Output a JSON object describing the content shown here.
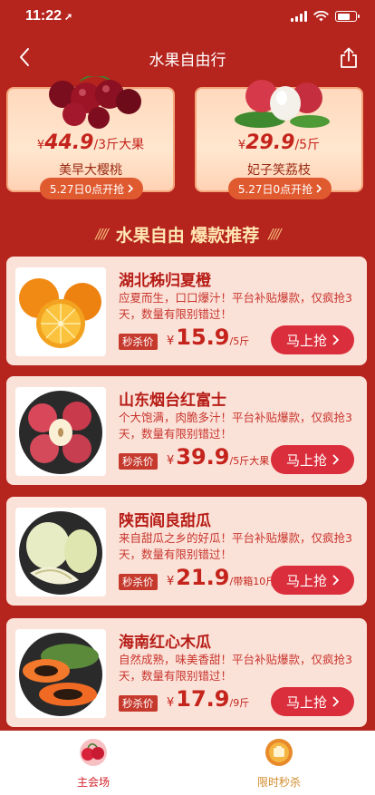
{
  "status": {
    "time": "11:22",
    "location_glyph": "➚"
  },
  "nav": {
    "title": "水果自由行"
  },
  "promos": [
    {
      "price_symbol": "¥",
      "price": "44.9",
      "unit": "/3斤大果",
      "name": "美早大樱桃",
      "button": "5.27日0点开抢",
      "icon": "cherries"
    },
    {
      "price_symbol": "¥",
      "price": "29.9",
      "unit": "/5斤",
      "name": "妃子笑荔枝",
      "button": "5.27日0点开抢",
      "icon": "lychees"
    }
  ],
  "section": {
    "title": "水果自由 爆款推荐",
    "slashes": "////"
  },
  "products": [
    {
      "name": "湖北秭归夏橙",
      "desc": "应夏而生，口口爆汁！平台补贴爆款，仅疯抢3天，数量有限别错过！",
      "tag": "秒杀价",
      "price_symbol": "¥",
      "price": "15.9",
      "unit": "/5斤",
      "button": "马上抢",
      "icon": "oranges"
    },
    {
      "name": "山东烟台红富士",
      "desc": "个大饱满，肉脆多汁！平台补贴爆款，仅疯抢3天，数量有限别错过！",
      "tag": "秒杀价",
      "price_symbol": "¥",
      "price": "39.9",
      "unit": "/5斤大果",
      "button": "马上抢",
      "icon": "apples"
    },
    {
      "name": "陕西阎良甜瓜",
      "desc": "来自甜瓜之乡的好瓜！平台补贴爆款，仅疯抢3天，数量有限别错过！",
      "tag": "秒杀价",
      "price_symbol": "¥",
      "price": "21.9",
      "unit": "/带箱10斤",
      "button": "马上抢",
      "icon": "melons"
    },
    {
      "name": "海南红心木瓜",
      "desc": "自然成熟，味美香甜！平台补贴爆款，仅疯抢3天，数量有限别错过！",
      "tag": "秒杀价",
      "price_symbol": "¥",
      "price": "17.9",
      "unit": "/9斤",
      "button": "马上抢",
      "icon": "papayas"
    }
  ],
  "tabs": [
    {
      "label": "主会场",
      "icon": "main-venue-icon",
      "active": true
    },
    {
      "label": "限时秒杀",
      "icon": "flash-sale-icon",
      "active": false
    }
  ],
  "colors": {
    "background": "#b5241d",
    "accent": "#c4241c",
    "button": "#db2e3c",
    "card": "#fbe2d8"
  }
}
